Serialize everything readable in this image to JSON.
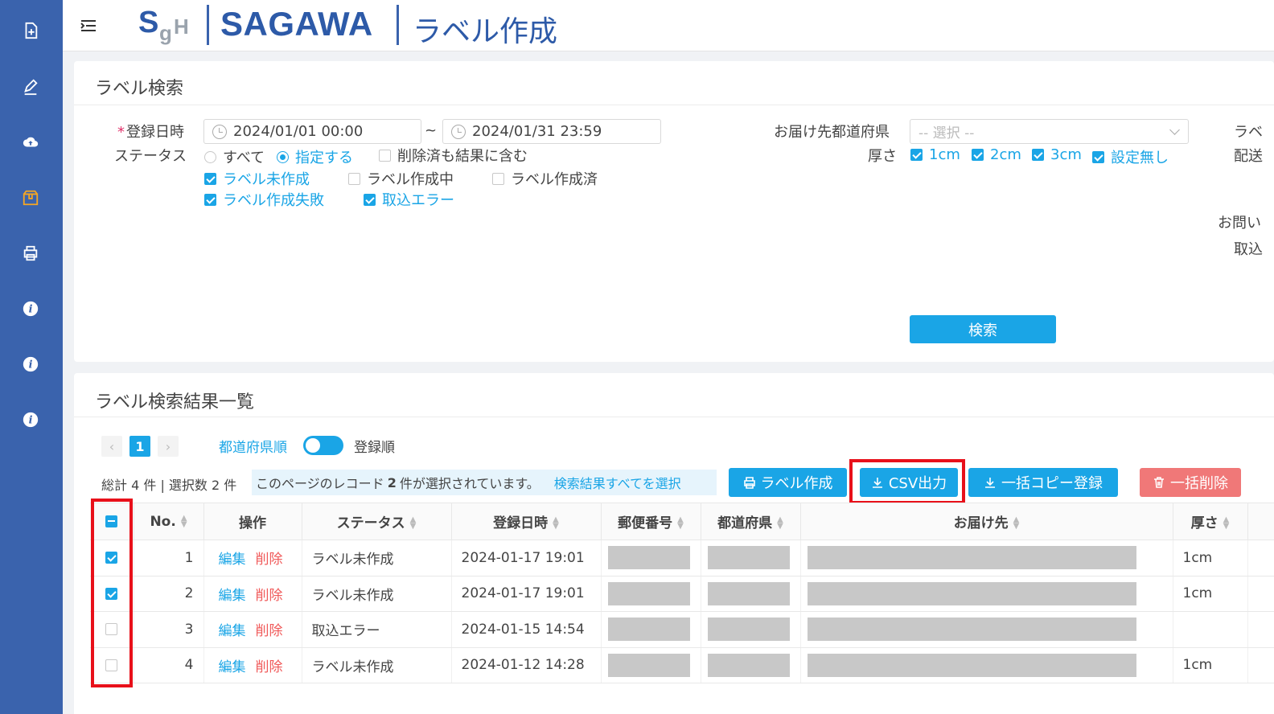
{
  "colors": {
    "sidebar": "#3a63ad",
    "accent": "#1aa5e6",
    "danger": "#f07878",
    "highlight": "#e8101a",
    "brand": "#2d5aa8"
  },
  "sidebar": {
    "icons": [
      "new-document-icon",
      "pen-edit-icon",
      "cloud-upload-icon",
      "package-box-icon",
      "printer-icon",
      "info-icon",
      "info-icon",
      "info-icon"
    ]
  },
  "header": {
    "brand": "SAGAWA",
    "title": "ラベル作成"
  },
  "search": {
    "title": "ラベル検索",
    "reg_date_label": "登録日時",
    "required_mark": "*",
    "date_from": "2024/01/01 00:00",
    "date_sep": "~",
    "date_to": "2024/01/31 23:59",
    "status_label": "ステータス",
    "radio_all": "すべて",
    "radio_specify": "指定する",
    "include_deleted": "削除済も結果に含む",
    "statuses": [
      {
        "label": "ラベル未作成",
        "checked": true
      },
      {
        "label": "ラベル作成中",
        "checked": false
      },
      {
        "label": "ラベル作成済",
        "checked": false
      },
      {
        "label": "ラベル作成失敗",
        "checked": true
      },
      {
        "label": "取込エラー",
        "checked": true
      }
    ],
    "pref_label": "お届け先都道府県",
    "pref_placeholder": "-- 選択 --",
    "thickness_label": "厚さ",
    "thickness": [
      {
        "label": "1cm",
        "checked": true
      },
      {
        "label": "2cm",
        "checked": true
      },
      {
        "label": "3cm",
        "checked": true
      },
      {
        "label": "設定無し",
        "checked": true
      }
    ],
    "cut_labels": [
      "ラベ",
      "配送",
      "お問い",
      "取込"
    ],
    "search_button": "検索"
  },
  "results": {
    "title": "ラベル検索結果一覧",
    "page": "1",
    "sort_left": "都道府県順",
    "sort_right": "登録順",
    "summary": "総計 4 件 | 選択数 2 件",
    "selection_msg_pre": "このページのレコード",
    "selection_msg_count": "2",
    "selection_msg_post": "件が選択されています。",
    "select_all_link": "検索結果すべてを選択",
    "buttons": {
      "create": "ラベル作成",
      "csv": "CSV出力",
      "copy": "一括コピー登録",
      "delete": "一括削除"
    },
    "columns": [
      "No.",
      "操作",
      "ステータス",
      "登録日時",
      "郵便番号",
      "都道府県",
      "お届け先",
      "厚さ"
    ],
    "edit_label": "編集",
    "delete_label": "削除",
    "rows": [
      {
        "checked": true,
        "no": "1",
        "status": "ラベル未作成",
        "date": "2024-01-17 19:01",
        "thickness": "1cm"
      },
      {
        "checked": true,
        "no": "2",
        "status": "ラベル未作成",
        "date": "2024-01-17 19:01",
        "thickness": "1cm"
      },
      {
        "checked": false,
        "no": "3",
        "status": "取込エラー",
        "date": "2024-01-15 14:54",
        "thickness": ""
      },
      {
        "checked": false,
        "no": "4",
        "status": "ラベル未作成",
        "date": "2024-01-12 14:28",
        "thickness": "1cm"
      }
    ]
  }
}
